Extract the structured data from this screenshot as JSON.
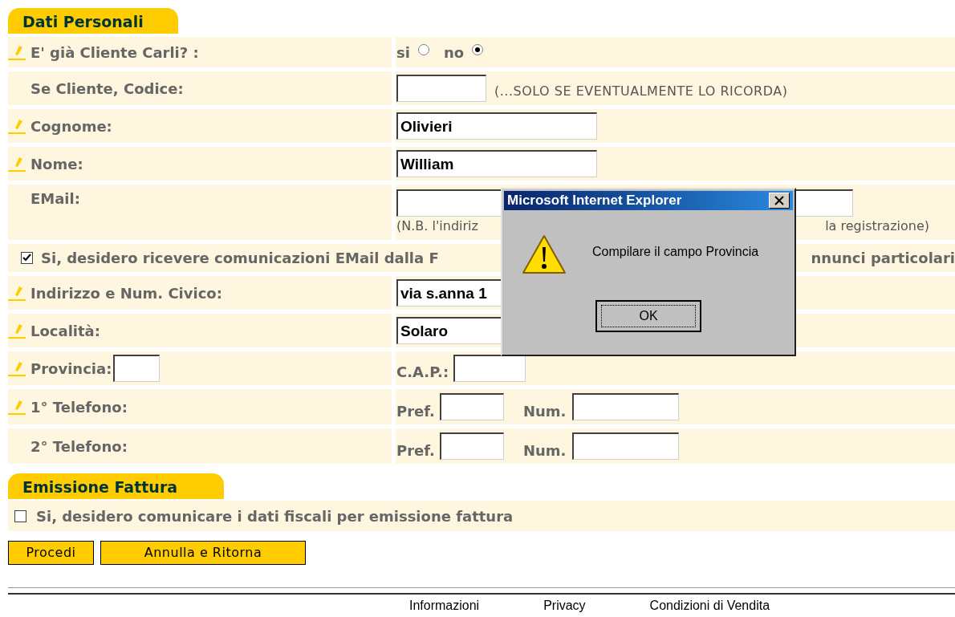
{
  "personal": {
    "title": "Dati Personali",
    "rows": [
      {
        "kind": "radio",
        "required": true,
        "label": "E' già Cliente Carli? :",
        "options": [
          {
            "label": "si",
            "selected": false
          },
          {
            "label": "no",
            "selected": true
          }
        ]
      },
      {
        "kind": "code",
        "required": false,
        "label": "Se Cliente, Codice:",
        "note": "(...SOLO SE EVENTUALMENTE LO RICORDA)"
      },
      {
        "kind": "text",
        "required": true,
        "label": "Cognome:",
        "value": "Olivieri"
      },
      {
        "kind": "text",
        "required": true,
        "label": "Nome:",
        "value": "William"
      },
      {
        "kind": "email",
        "required": false,
        "label": "EMail:",
        "note_start": "(N.B. l'indiriz",
        "note_end": "la registrazione)"
      },
      {
        "kind": "consent",
        "checked": true,
        "text_start": "Si, desidero ricevere comunicazioni EMail dalla F",
        "text_end": "nnunci particolari"
      },
      {
        "kind": "text",
        "required": true,
        "label": "Indirizzo e Num. Civico:",
        "value": "via s.anna 1"
      },
      {
        "kind": "text",
        "required": true,
        "label": "Località:",
        "value": "Solaro"
      },
      {
        "kind": "provincia",
        "required": true,
        "label": "Provincia:",
        "cap_label": "C.A.P.:"
      },
      {
        "kind": "phone",
        "required": true,
        "label": "1° Telefono:",
        "pref_label": "Pref.",
        "num_label": "Num."
      },
      {
        "kind": "phone",
        "required": false,
        "label": "2° Telefono:",
        "pref_label": "Pref.",
        "num_label": "Num."
      }
    ]
  },
  "invoice": {
    "title": "Emissione Fattura",
    "checked": false,
    "text": "Si, desidero comunicare i dati fiscali per emissione fattura"
  },
  "buttons": [
    "Procedi",
    "Annulla e Ritorna"
  ],
  "footer_links": [
    "Informazioni",
    "Privacy",
    "Condizioni di Vendita"
  ],
  "dialog": {
    "title": "Microsoft Internet Explorer",
    "message": "Compilare il campo Provincia",
    "button": "OK"
  }
}
